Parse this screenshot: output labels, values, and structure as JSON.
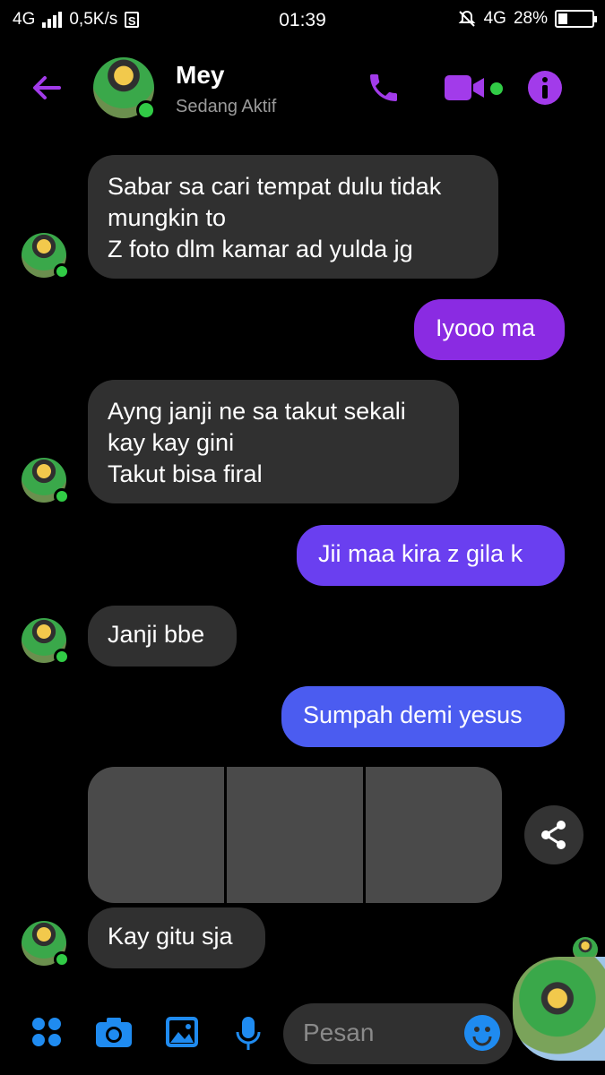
{
  "status_bar": {
    "network_left": "4G",
    "speed": "0,5K/s",
    "s_badge": "S",
    "time": "01:39",
    "network_right": "4G",
    "battery_percent": "28%",
    "battery_level": 0.28
  },
  "header": {
    "contact_name": "Mey",
    "contact_status": "Sedang Aktif"
  },
  "messages": [
    {
      "direction": "in",
      "lines": [
        "Sabar sa cari tempat dulu tidak",
        "mungkin to",
        "Z foto dlm kamar ad yulda jg"
      ]
    },
    {
      "direction": "out",
      "lines": [
        "Iyooo ma"
      ]
    },
    {
      "direction": "in",
      "lines": [
        "Ayng janji ne sa takut sekali",
        "kay kay gini",
        "Takut bisa firal"
      ]
    },
    {
      "direction": "out",
      "lines": [
        "Jii maa kira z gila k"
      ]
    },
    {
      "direction": "in",
      "lines": [
        "Janji bbe"
      ]
    },
    {
      "direction": "out",
      "lines": [
        "Sumpah demi yesus"
      ]
    },
    {
      "direction": "in",
      "lines": [
        "Kay gitu sja"
      ]
    }
  ],
  "media": {
    "count": 3,
    "label": ""
  },
  "composer": {
    "placeholder": "Pesan"
  },
  "colors": {
    "accent_purple": "#a23bea",
    "bubble_in": "#303030",
    "bubble_out_1": "#8a2be2",
    "bubble_out_2": "#6a3ff0",
    "bubble_out_3": "#4b5cf0",
    "emoji_blue": "#1f8bf0",
    "online_green": "#31cc46"
  },
  "icons": [
    "back-arrow-icon",
    "phone-icon",
    "video-camera-icon",
    "info-icon",
    "share-icon",
    "grid-menu-icon",
    "camera-icon",
    "gallery-icon",
    "microphone-icon",
    "emoji-icon"
  ]
}
